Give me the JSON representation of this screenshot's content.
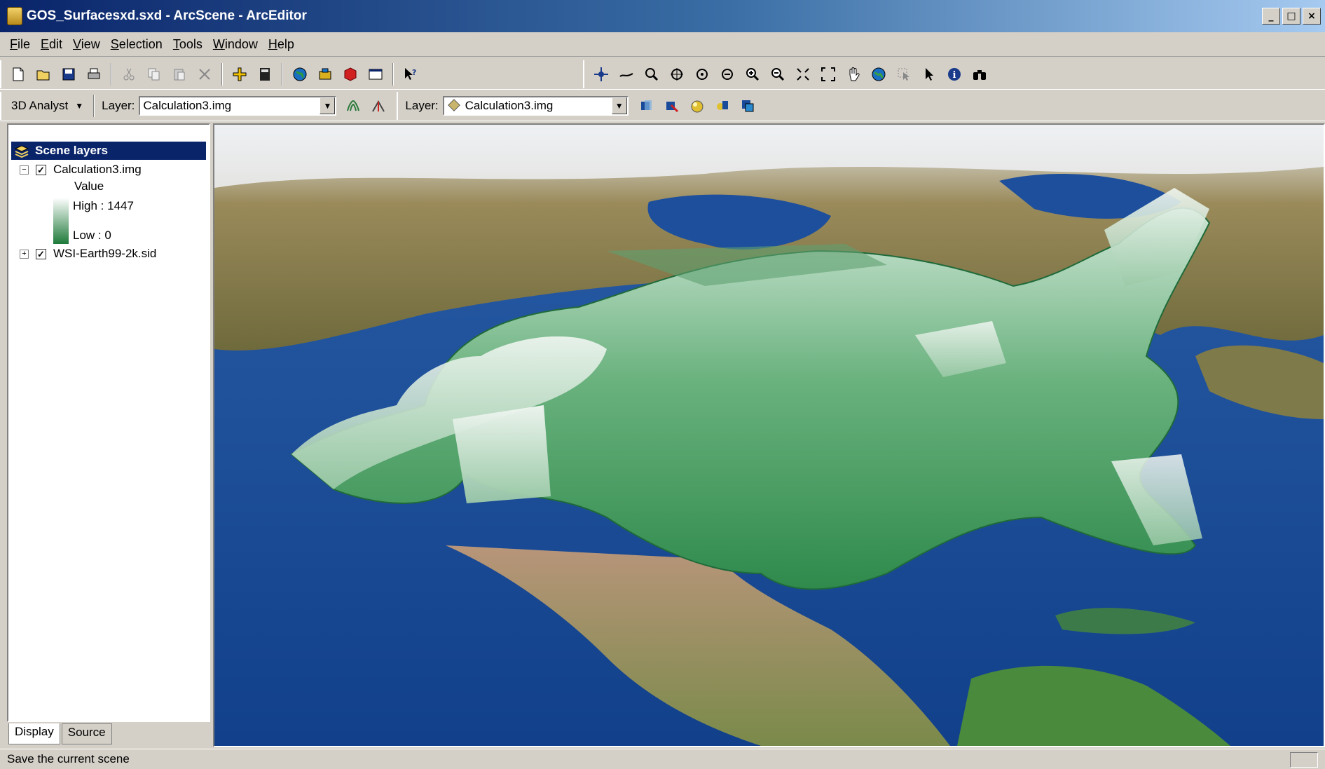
{
  "window": {
    "title": "GOS_Surfacesxd.sxd - ArcScene - ArcEditor",
    "minimize": "_",
    "maximize": "□",
    "close": "×"
  },
  "menu": [
    {
      "label": "File",
      "key": "F",
      "rest": "ile"
    },
    {
      "label": "Edit",
      "key": "E",
      "rest": "dit"
    },
    {
      "label": "View",
      "key": "V",
      "rest": "iew"
    },
    {
      "label": "Selection",
      "key": "S",
      "rest": "election"
    },
    {
      "label": "Tools",
      "key": "T",
      "rest": "ools"
    },
    {
      "label": "Window",
      "key": "W",
      "rest": "indow"
    },
    {
      "label": "Help",
      "key": "H",
      "rest": "elp"
    }
  ],
  "analyst_toolbar": {
    "dropdown_label": "3D Analyst",
    "layer_label": "Layer:",
    "layer_value": "Calculation3.img"
  },
  "effects_toolbar": {
    "layer_label": "Layer:",
    "layer_value": "Calculation3.img"
  },
  "toc": {
    "root_label": "Scene layers",
    "layers": [
      {
        "name": "Calculation3.img",
        "checked": true,
        "expanded": true
      },
      {
        "name": "WSI-Earth99-2k.sid",
        "checked": true,
        "expanded": false
      }
    ],
    "legend": {
      "field": "Value",
      "high": "High : 1447",
      "low": "Low : 0",
      "colors": [
        "#ffffff",
        "#1e7a3a"
      ]
    },
    "tabs": [
      "Display",
      "Source"
    ]
  },
  "status": {
    "message": "Save the current scene"
  },
  "colors": {
    "title_start": "#0a246a",
    "title_end": "#a6caf0",
    "ocean": "#1c4f9c",
    "land": "#8a7a4a",
    "surface": "#3f9a5c"
  }
}
